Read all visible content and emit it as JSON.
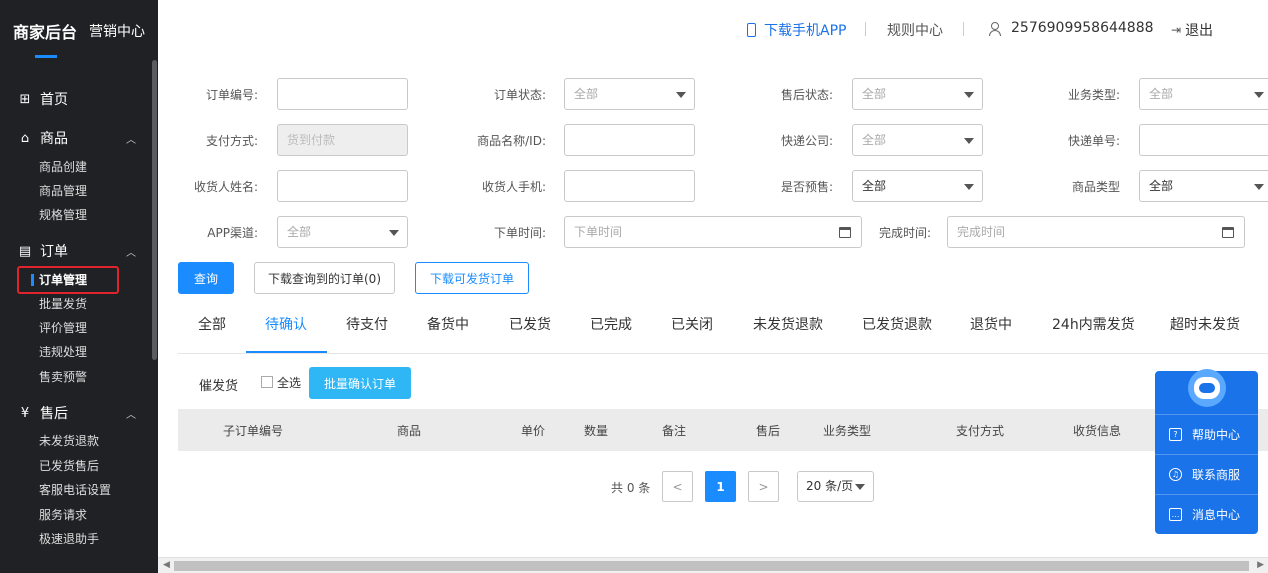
{
  "brand": {
    "title": "商家后台",
    "subtitle": "营销中心"
  },
  "sidebar": {
    "home": "首页",
    "groups": [
      {
        "label": "商品",
        "items": [
          "商品创建",
          "商品管理",
          "规格管理"
        ]
      },
      {
        "label": "订单",
        "items": [
          "订单管理",
          "批量发货",
          "评价管理",
          "违规处理",
          "售卖预警"
        ]
      },
      {
        "label": "售后",
        "items": [
          "未发货退款",
          "已发货售后",
          "客服电话设置",
          "服务请求",
          "极速退助手"
        ]
      }
    ],
    "active_item": "订单管理"
  },
  "header": {
    "download_app": "下载手机APP",
    "rules": "规则中心",
    "user_id": "2576909958644888",
    "logout": "退出"
  },
  "filters": {
    "order_no": {
      "label": "订单编号:",
      "value": ""
    },
    "order_status": {
      "label": "订单状态:",
      "value": "全部"
    },
    "after_sale_status": {
      "label": "售后状态:",
      "value": "全部"
    },
    "biz_type": {
      "label": "业务类型:",
      "value": "全部"
    },
    "pay_method": {
      "label": "支付方式:",
      "value": "货到付款"
    },
    "product_name": {
      "label": "商品名称/ID:",
      "value": ""
    },
    "courier": {
      "label": "快递公司:",
      "value": "全部"
    },
    "tracking_no": {
      "label": "快递单号:",
      "value": ""
    },
    "receiver_name": {
      "label": "收货人姓名:",
      "value": ""
    },
    "receiver_phone": {
      "label": "收货人手机:",
      "value": ""
    },
    "presale": {
      "label": "是否预售:",
      "value": "全部"
    },
    "product_type": {
      "label": "商品类型",
      "value": "全部"
    },
    "app_channel": {
      "label": "APP渠道:",
      "value": "全部"
    },
    "order_time": {
      "label": "下单时间:",
      "placeholder": "下单时间"
    },
    "finish_time": {
      "label": "完成时间:",
      "placeholder": "完成时间"
    }
  },
  "actions": {
    "query": "查询",
    "download_queried": "下载查询到的订单(0)",
    "download_shippable": "下载可发货订单"
  },
  "tabs": [
    "全部",
    "待确认",
    "待支付",
    "备货中",
    "已发货",
    "已完成",
    "已关闭",
    "未发货退款",
    "已发货退款",
    "退货中",
    "24h内需发货",
    "超时未发货"
  ],
  "active_tab": "待确认",
  "bulk": {
    "urge": "催发货",
    "select_all": "全选",
    "batch_confirm": "批量确认订单"
  },
  "table": {
    "columns": [
      "子订单编号",
      "商品",
      "单价",
      "数量",
      "备注",
      "售后",
      "业务类型",
      "支付方式",
      "收货信息"
    ]
  },
  "pagination": {
    "total": "共 0 条",
    "prev": "<",
    "current": "1",
    "next": ">",
    "page_size": "20 条/页"
  },
  "float_widget": {
    "help": "帮助中心",
    "contact": "联系商服",
    "messages": "消息中心"
  }
}
